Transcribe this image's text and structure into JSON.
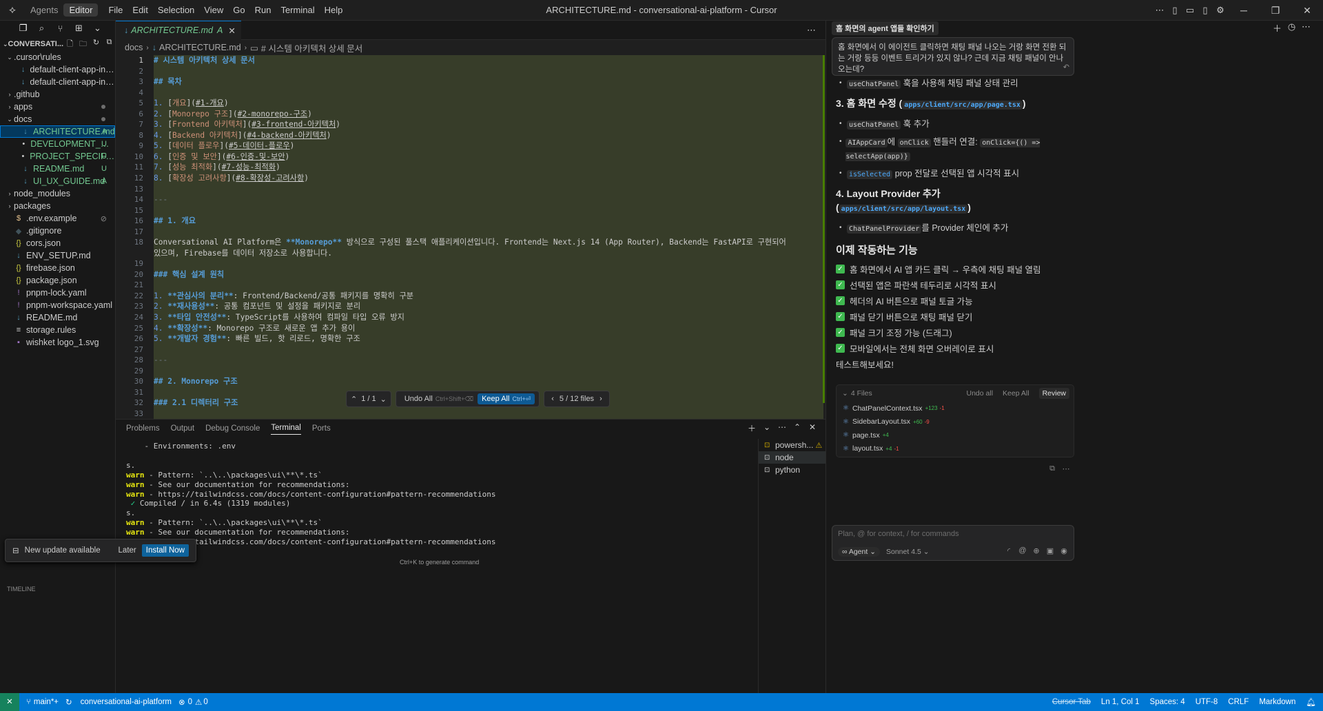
{
  "titlebar": {
    "mode_tabs": [
      "Agents",
      "Editor"
    ],
    "active_mode": "Editor",
    "menu": [
      "File",
      "Edit",
      "Selection",
      "View",
      "Go",
      "Run",
      "Terminal",
      "Help"
    ],
    "title": "ARCHITECTURE.md - conversational-ai-platform - Cursor"
  },
  "sidebar": {
    "explorer_title": "CONVERSATI...",
    "items": [
      {
        "label": ".cursor\\rules",
        "type": "folder",
        "expanded": true,
        "depth": 0
      },
      {
        "label": "default-client-app-instruct...",
        "type": "file",
        "depth": 1
      },
      {
        "label": "default-client-app-instruct...",
        "type": "file",
        "depth": 1
      },
      {
        "label": ".github",
        "type": "folder",
        "depth": 0
      },
      {
        "label": "apps",
        "type": "folder",
        "depth": 0,
        "dot": true
      },
      {
        "label": "docs",
        "type": "folder",
        "expanded": true,
        "depth": 0,
        "dot": true
      },
      {
        "label": "ARCHITECTURE.md",
        "type": "file",
        "depth": 1,
        "badge": "A",
        "selected": true
      },
      {
        "label": "DEVELOPMENT_GUID...",
        "type": "file",
        "depth": 1,
        "badge": "U"
      },
      {
        "label": "PROJECT_SPECIFICATI...",
        "type": "file",
        "depth": 1,
        "badge": "U"
      },
      {
        "label": "README.md",
        "type": "file",
        "depth": 1,
        "badge": "U"
      },
      {
        "label": "UI_UX_GUIDE.md",
        "type": "file",
        "depth": 1,
        "badge": "A"
      },
      {
        "label": "node_modules",
        "type": "folder",
        "depth": 0
      },
      {
        "label": "packages",
        "type": "folder",
        "depth": 0
      },
      {
        "label": ".env.example",
        "type": "file",
        "depth": 0
      },
      {
        "label": ".gitignore",
        "type": "file",
        "depth": 0
      },
      {
        "label": "cors.json",
        "type": "file",
        "depth": 0
      },
      {
        "label": "ENV_SETUP.md",
        "type": "file",
        "depth": 0
      },
      {
        "label": "firebase.json",
        "type": "file",
        "depth": 0
      },
      {
        "label": "package.json",
        "type": "file",
        "depth": 0
      },
      {
        "label": "pnpm-lock.yaml",
        "type": "file",
        "depth": 0
      },
      {
        "label": "pnpm-workspace.yaml",
        "type": "file",
        "depth": 0
      },
      {
        "label": "README.md",
        "type": "file",
        "depth": 0
      },
      {
        "label": "storage.rules",
        "type": "file",
        "depth": 0
      },
      {
        "label": "wishket logo_1.svg",
        "type": "file",
        "depth": 0
      }
    ],
    "timeline_label": "TIMELINE"
  },
  "editor": {
    "tab_label": "ARCHITECTURE.md",
    "tab_status": "A",
    "breadcrumb": [
      "docs",
      "ARCHITECTURE.md",
      "# 시스템 아키텍처 상세 문서"
    ],
    "lines": [
      "# 시스템 아키텍처 상세 문서",
      "",
      "## 목차",
      "",
      "1. [개요](#1-개요)",
      "2. [Monorepo 구조](#2-monorepo-구조)",
      "3. [Frontend 아키텍처](#3-frontend-아키텍처)",
      "4. [Backend 아키텍처](#4-backend-아키텍처)",
      "5. [데이터 플로우](#5-데이터-플로우)",
      "6. [인증 및 보안](#6-인증-및-보안)",
      "7. [성능 최적화](#7-성능-최적화)",
      "8. [확장성 고려사항](#8-확장성-고려사항)",
      "",
      "---",
      "",
      "## 1. 개요",
      "",
      "Conversational AI Platform은 **Monorepo** 방식으로 구성된 풀스택 애플리케이션입니다. Frontend는 Next.js 14 (App Router), Backend는 FastAPI로 구현되어\n있으며, Firebase를 데이터 저장소로 사용합니다.",
      "",
      "### 핵심 설계 원칙",
      "",
      "1. **관심사의 분리**: Frontend/Backend/공통 패키지를 명확히 구분",
      "2. **재사용성**: 공통 컴포넌트 및 설정을 패키지로 분리",
      "3. **타입 안전성**: TypeScript를 사용하여 컴파일 타입 오류 방지",
      "4. **확장성**: Monorepo 구조로 새로운 앱 추가 용이",
      "5. **개발자 경험**: 빠른 빌드, 핫 리로드, 명확한 구조",
      "",
      "---",
      "",
      "## 2. Monorepo 구조",
      "",
      "### 2.1 디렉터리 구조",
      ""
    ],
    "diff_toolbar": {
      "hunk": "1 / 1",
      "undo_all": "Undo All",
      "undo_kb": "Ctrl+Shift+⌫",
      "keep_all": "Keep All",
      "keep_kb": "Ctrl+⏎",
      "files": "5 / 12 files"
    }
  },
  "panel": {
    "tabs": [
      "Problems",
      "Output",
      "Debug Console",
      "Terminal",
      "Ports"
    ],
    "active_tab": "Terminal",
    "terminal_lines": [
      {
        "t": "    - Environments: .env",
        "k": "plain"
      },
      {
        "t": "",
        "k": "plain"
      },
      {
        "t": "s.",
        "k": "plain"
      },
      {
        "t": " - Pattern: `..\\..\\packages\\ui\\**\\*.ts`",
        "k": "warn"
      },
      {
        "t": " - See our documentation for recommendations:",
        "k": "warn"
      },
      {
        "t": " - https://tailwindcss.com/docs/content-configuration#pattern-recommendations",
        "k": "warn"
      },
      {
        "t": " Compiled / in 6.4s (1319 modules)",
        "k": "ok"
      },
      {
        "t": "s.",
        "k": "plain"
      },
      {
        "t": " - Pattern: `..\\..\\packages\\ui\\**\\*.ts`",
        "k": "warn"
      },
      {
        "t": " - See our documentation for recommendations:",
        "k": "warn"
      },
      {
        "t": " - https://tailwindcss.com/docs/content-configuration#pattern-recommendations",
        "k": "warn"
      }
    ],
    "warn_prefix": "warn",
    "terminals": [
      "powersh...",
      "node",
      "python"
    ],
    "ctrl_k_hint": "Ctrl+K to generate command"
  },
  "update_toast": {
    "message": "New update available",
    "later": "Later",
    "install": "Install Now"
  },
  "chat": {
    "tab_title": "홈 화면의 agent 앱들 확인하기",
    "user_message": "홈 화면에서 이 에이전트 클릭하면 채팅 패널 나오는 거랑 화면 전환 되는 거랑 등등 이벤트 트리거가 있지 않나? 근데 지금 채팅 패널이 안나오는데?",
    "b1_code": "useChatPanel",
    "b1_text": " 훅을 사용해 채팅 패널 상태 관리",
    "h3_prefix": "3. 홈 화면 수정 (",
    "h3_path": "apps/client/src/app/page.tsx",
    "h3_suffix": ")",
    "b2_code": "useChatPanel",
    "b2_text": " 훅 추가",
    "b3_code": "AIAppCard",
    "b3_mid": "에 ",
    "b3_code2": "onClick",
    "b3_text": " 핸들러 연결: ",
    "b3_code3": "onClick={() => selectApp(app)}",
    "b4_code": "isSelected",
    "b4_text": " prop 전달로 선택된 앱 시각적 표시",
    "h4_prefix": "4. Layout Provider 추가 (",
    "h4_path": "apps/client/src/app/layout.tsx",
    "h4_suffix": ")",
    "b5_code": "ChatPanelProvider",
    "b5_text": "를 Provider 체인에 추가",
    "works_heading": "이제 작동하는 기능",
    "checks": [
      "홈 화면에서 AI 앱 카드 클릭 → 우측에 채팅 패널 열림",
      "선택된 앱은 파란색 테두리로 시각적 표시",
      "헤더의 AI 버튼으로 패널 토글 가능",
      "패널 닫기 버튼으로 채팅 패널 닫기",
      "패널 크기 조정 가능 (드래그)",
      "모바일에서는 전체 화면 오버레이로 표시"
    ],
    "test_prompt": "테스트해보세요!",
    "files_box": {
      "count": "4 Files",
      "undo_all": "Undo all",
      "keep_all": "Keep All",
      "review": "Review",
      "files": [
        {
          "name": "ChatPanelContext.tsx",
          "add": "+123",
          "del": "-1"
        },
        {
          "name": "SidebarLayout.tsx",
          "add": "+60",
          "del": "-9"
        },
        {
          "name": "page.tsx",
          "add": "+4",
          "del": ""
        },
        {
          "name": "layout.tsx",
          "add": "+4",
          "del": "-1"
        }
      ]
    },
    "composer": {
      "placeholder": "Plan, @ for context, / for commands",
      "mode": "Agent",
      "model": "Sonnet 4.5"
    }
  },
  "statusbar": {
    "branch": "main*+",
    "project": "conversational-ai-platform",
    "problems": "0",
    "warnings": "0",
    "cursor_tab": "Cursor Tab",
    "position": "Ln 1, Col 1",
    "spaces": "Spaces: 4",
    "encoding": "UTF-8",
    "eol": "CRLF",
    "language": "Markdown"
  },
  "colors": {
    "accent": "#0078d4",
    "diff_bg": "#373d29",
    "added_badge": "#73c991",
    "untracked_badge": "#73c991"
  }
}
